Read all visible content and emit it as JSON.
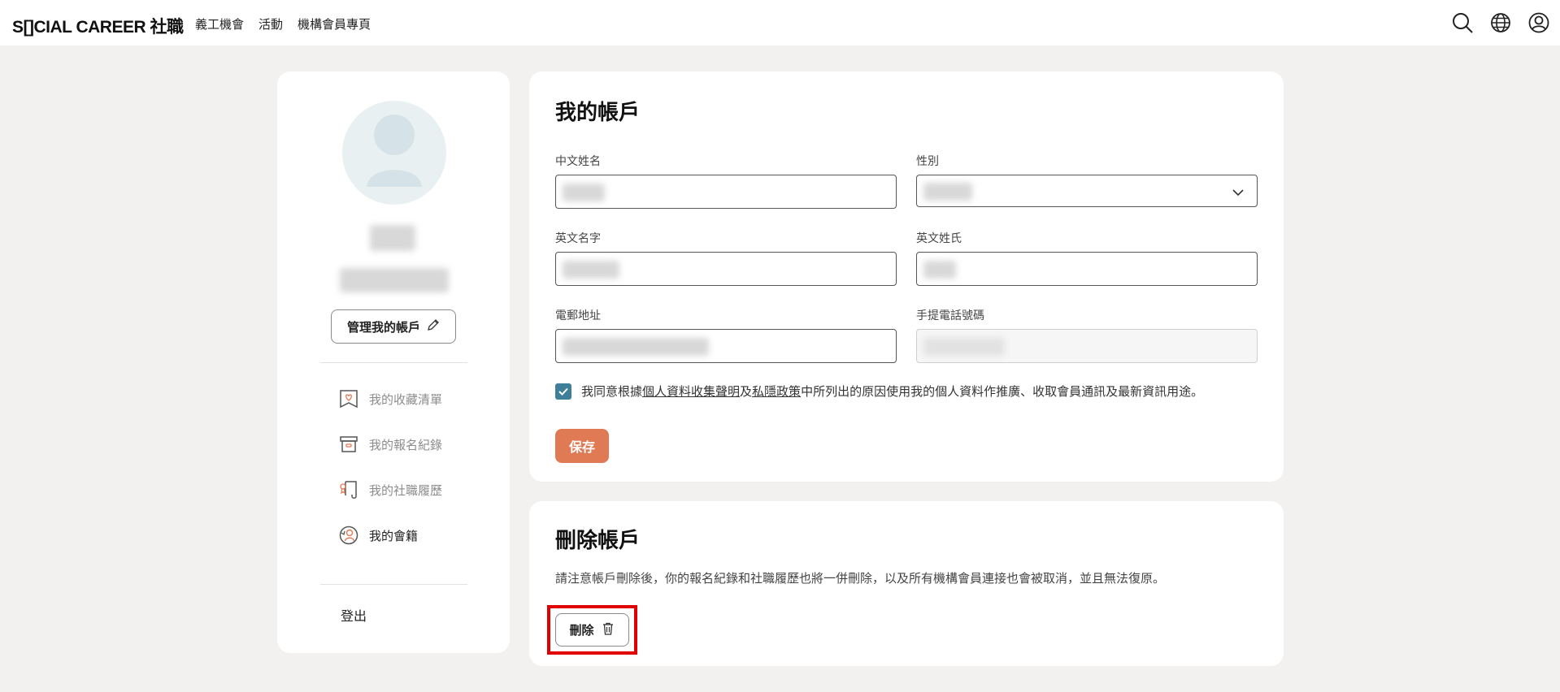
{
  "header": {
    "logo": "S[]CIAL CAREER 社職",
    "nav": [
      "義工機會",
      "活動",
      "機構會員專頁"
    ],
    "icons": [
      "search-icon",
      "globe-icon",
      "user-icon"
    ]
  },
  "sidebar": {
    "manage_label": "管理我的帳戶",
    "items": [
      {
        "label": "我的收藏清單",
        "icon": "bookmark-heart-icon",
        "active": false
      },
      {
        "label": "我的報名紀錄",
        "icon": "archive-box-icon",
        "active": false
      },
      {
        "label": "我的社職履歷",
        "icon": "resume-scroll-icon",
        "active": false
      },
      {
        "label": "我的會籍",
        "icon": "membership-badge-icon",
        "active": true
      }
    ],
    "logout_label": "登出"
  },
  "account": {
    "title": "我的帳戶",
    "fields": {
      "chinese_name_label": "中文姓名",
      "gender_label": "性別",
      "english_first_label": "英文名字",
      "english_last_label": "英文姓氏",
      "email_label": "電郵地址",
      "phone_label": "手提電話號碼"
    },
    "consent": {
      "prefix": "我同意根據",
      "link1": "個人資料收集聲明",
      "and": "及",
      "link2": "私隱政策",
      "suffix": "中所列出的原因使用我的個人資料作推廣、收取會員通訊及最新資訊用途。",
      "checked": true
    },
    "save_label": "保存"
  },
  "delete_account": {
    "title": "刪除帳戶",
    "note": "請注意帳戶刪除後，你的報名紀錄和社職履歷也將一併刪除，以及所有機構會員連接也會被取消，並且無法復原。",
    "delete_label": "刪除"
  },
  "colors": {
    "accent": "#e07a55",
    "checkbox": "#3f7f9a",
    "highlight": "#e00000",
    "background": "#f2f1ef"
  }
}
